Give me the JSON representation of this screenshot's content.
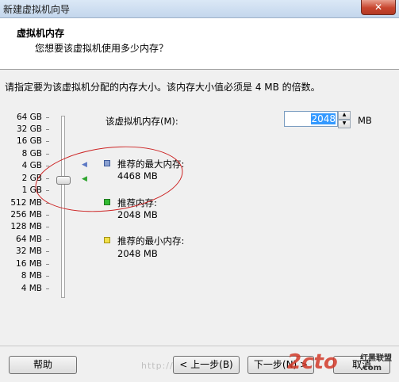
{
  "window": {
    "title": "新建虚拟机向导",
    "close_glyph": "✕"
  },
  "header": {
    "title": "虚拟机内存",
    "subtitle": "您想要该虚拟机使用多少内存？"
  },
  "instruction": "请指定要为该虚拟机分配的内存大小。该内存大小值必须是 4 MB 的倍数。",
  "memory": {
    "label": "该虚拟机内存(M):",
    "value": "2048",
    "unit": "MB"
  },
  "scale_ticks": [
    "64 GB",
    "32 GB",
    "16 GB",
    "8 GB",
    "4 GB",
    "2 GB",
    "1 GB",
    "512 MB",
    "256 MB",
    "128 MB",
    "64 MB",
    "32 MB",
    "16 MB",
    "8 MB",
    "4 MB"
  ],
  "slider": {
    "current_value_mb": 2048
  },
  "legend": {
    "max": {
      "label": "推荐的最大内存:",
      "value": "4468 MB",
      "color": "#8aa0d0"
    },
    "rec": {
      "label": "推荐内存:",
      "value": "2048 MB",
      "color": "#33bb33"
    },
    "min": {
      "label": "推荐的最小内存:",
      "value": "2048 MB",
      "color": "#f2e04a"
    }
  },
  "buttons": {
    "help": "帮助",
    "back": "< 上一步(B)",
    "next": "下一步(N) >",
    "cancel": "取消"
  },
  "watermark": {
    "url": "http://",
    "logo": "2cto",
    "brand_line1": "红黑联盟",
    "brand_line2": ".com"
  }
}
